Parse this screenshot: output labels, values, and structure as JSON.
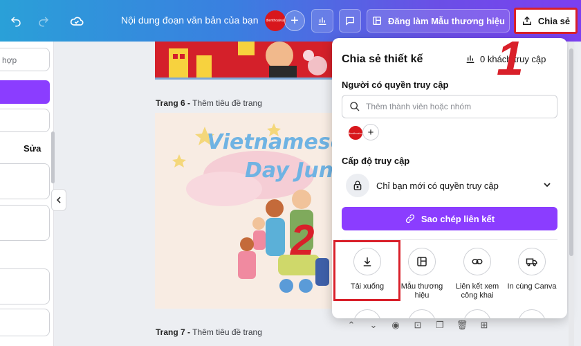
{
  "topbar": {
    "undo_icon": "undo-icon",
    "redo_icon": "redo-icon",
    "cloud_icon": "cloud-check-icon",
    "title": "Nội dung đoạn văn bản của bạn",
    "brand_avatar_text": "dienthoaivui",
    "brand_template_label": "Đăng làm Mẫu thương hiệu",
    "share_label": "Chia sẻ"
  },
  "left_panel": {
    "search_placeholder_fragment": "hợp",
    "edit_label": "Sửa"
  },
  "canvas": {
    "page6_label_prefix": "Trang 6 -",
    "page6_label_title": "Thêm tiêu đề trang",
    "page7_label_prefix": "Trang 7 -",
    "page7_label_title": "Thêm tiêu đề trang",
    "page6_text_line1": "Vietnamese",
    "page6_text_line2": "Day Jun"
  },
  "share_panel": {
    "title": "Chia sẻ thiết kế",
    "visits": "0 khách truy cập",
    "people_label": "Người có quyền truy cập",
    "search_placeholder": "Thêm thành viên hoặc nhóm",
    "access_level_label": "Cấp độ truy cập",
    "access_value": "Chỉ bạn mới có quyền truy cập",
    "copy_link_label": "Sao chép liên kết",
    "actions": [
      {
        "label": "Tải xuống",
        "icon": "download-icon"
      },
      {
        "label": "Mẫu thương hiệu",
        "icon": "brand-template-icon"
      },
      {
        "label": "Liên kết xem công khai",
        "icon": "link-icon"
      },
      {
        "label": "In cùng Canva",
        "icon": "truck-icon"
      }
    ]
  },
  "annotations": {
    "step1": "1",
    "step2": "2"
  },
  "colors": {
    "accent_purple": "#8b3dff",
    "highlight_red": "#d9202a"
  }
}
